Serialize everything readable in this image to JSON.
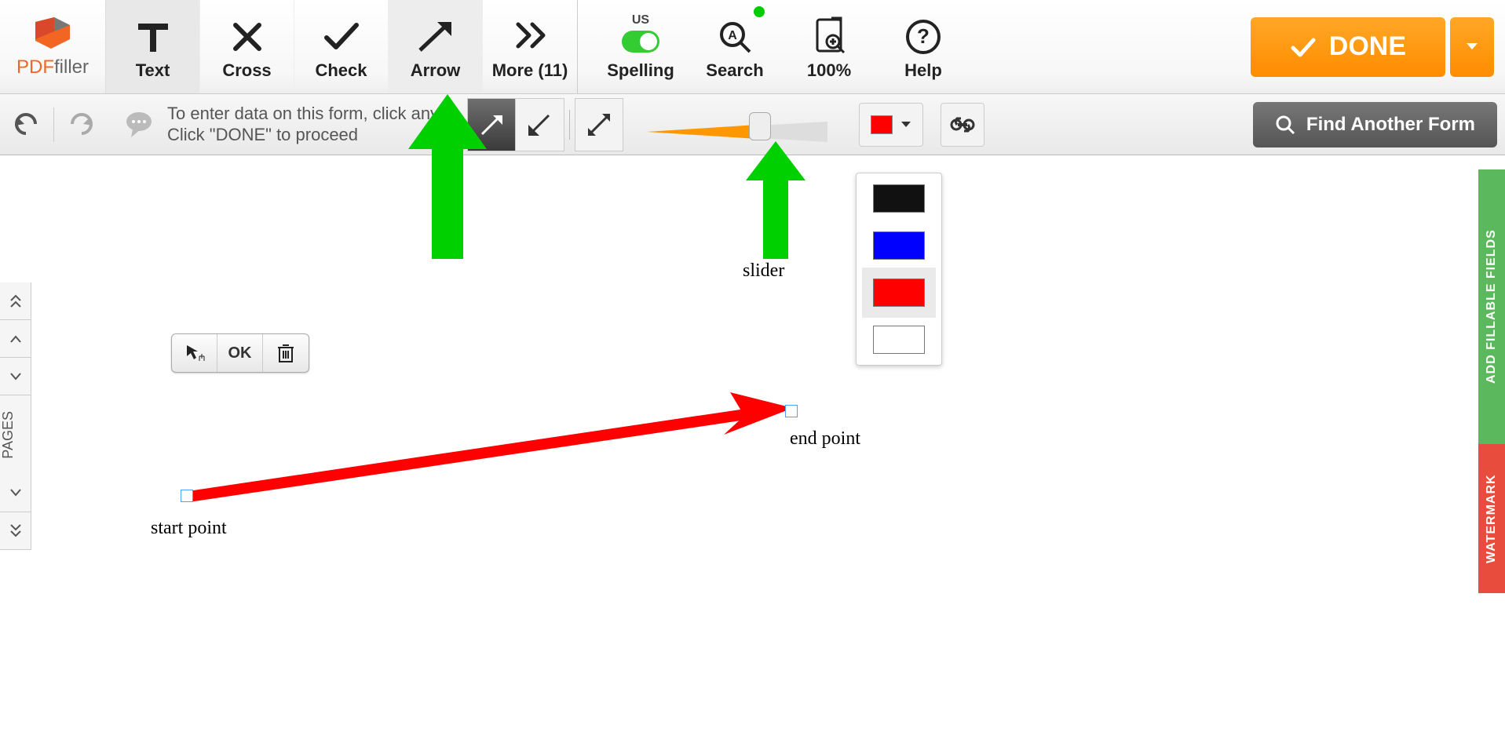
{
  "brand": {
    "pdf": "PDF",
    "filler": "filler"
  },
  "toolbar": {
    "text": "Text",
    "cross": "Cross",
    "check": "Check",
    "arrow": "Arrow",
    "more": "More (11)",
    "spelling": "Spelling",
    "spelling_lang": "US",
    "search": "Search",
    "zoom": "100%",
    "help": "Help",
    "done": "DONE"
  },
  "hint": {
    "line1": "To enter data on this form, click anyw",
    "line2": "Click \"DONE\" to proceed"
  },
  "find_form": "Find Another Form",
  "mini": {
    "ok": "OK"
  },
  "annotations": {
    "slider": "slider",
    "start": "start point",
    "end": "end point"
  },
  "colors": {
    "selected": "#ff0000",
    "options": [
      "#111111",
      "#0000ff",
      "#ff0000",
      "#ffffff"
    ]
  },
  "pages_label": "PAGES",
  "right_tabs": {
    "fillable": "ADD FILLABLE FIELDS",
    "watermark": "WATERMARK"
  }
}
